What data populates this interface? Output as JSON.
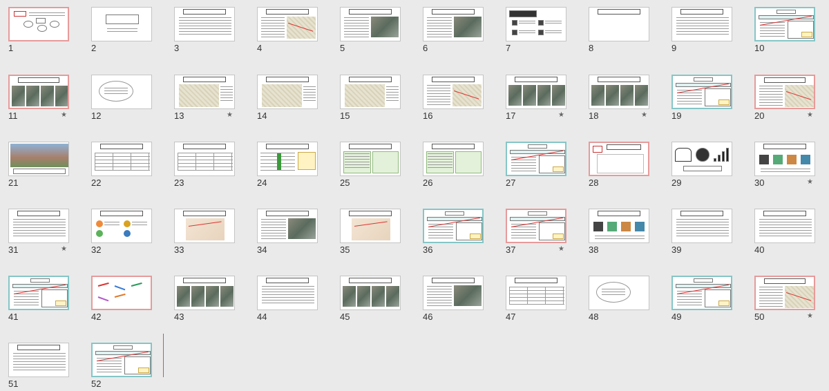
{
  "app": {
    "view": "Slide Sorter",
    "accent_color": "#c0603a"
  },
  "slides": [
    {
      "n": "1",
      "kind": "flow",
      "border": "red",
      "star": false
    },
    {
      "n": "2",
      "kind": "title",
      "border": "none",
      "star": false
    },
    {
      "n": "3",
      "kind": "text",
      "border": "none",
      "star": false
    },
    {
      "n": "4",
      "kind": "textmap",
      "border": "none",
      "star": false
    },
    {
      "n": "5",
      "kind": "textpic",
      "border": "none",
      "star": false
    },
    {
      "n": "6",
      "kind": "textpic",
      "border": "none",
      "star": false
    },
    {
      "n": "7",
      "kind": "list",
      "border": "none",
      "star": false
    },
    {
      "n": "8",
      "kind": "blank",
      "border": "none",
      "star": false
    },
    {
      "n": "9",
      "kind": "text",
      "border": "none",
      "star": false
    },
    {
      "n": "10",
      "kind": "lesson",
      "border": "teal",
      "star": false
    },
    {
      "n": "11",
      "kind": "photos",
      "border": "red",
      "star": true
    },
    {
      "n": "12",
      "kind": "cloud",
      "border": "none",
      "star": false
    },
    {
      "n": "13",
      "kind": "map",
      "border": "none",
      "star": true
    },
    {
      "n": "14",
      "kind": "map",
      "border": "none",
      "star": false
    },
    {
      "n": "15",
      "kind": "map",
      "border": "none",
      "star": false
    },
    {
      "n": "16",
      "kind": "textmap",
      "border": "none",
      "star": false
    },
    {
      "n": "17",
      "kind": "photos",
      "border": "none",
      "star": true
    },
    {
      "n": "18",
      "kind": "photos",
      "border": "none",
      "star": true
    },
    {
      "n": "19",
      "kind": "lesson",
      "border": "teal",
      "star": false
    },
    {
      "n": "20",
      "kind": "textmap",
      "border": "red",
      "star": true
    },
    {
      "n": "21",
      "kind": "photo",
      "border": "none",
      "star": false
    },
    {
      "n": "22",
      "kind": "table",
      "border": "none",
      "star": false
    },
    {
      "n": "23",
      "kind": "table",
      "border": "none",
      "star": false
    },
    {
      "n": "24",
      "kind": "greentable",
      "border": "none",
      "star": false
    },
    {
      "n": "25",
      "kind": "green",
      "border": "none",
      "star": false
    },
    {
      "n": "26",
      "kind": "green",
      "border": "none",
      "star": false
    },
    {
      "n": "27",
      "kind": "lesson",
      "border": "teal",
      "star": false
    },
    {
      "n": "28",
      "kind": "worldmap",
      "border": "red",
      "star": false
    },
    {
      "n": "29",
      "kind": "charts",
      "border": "none",
      "star": false
    },
    {
      "n": "30",
      "kind": "icons",
      "border": "none",
      "star": true
    },
    {
      "n": "31",
      "kind": "text",
      "border": "none",
      "star": true
    },
    {
      "n": "32",
      "kind": "circles",
      "border": "none",
      "star": false
    },
    {
      "n": "33",
      "kind": "sketch",
      "border": "none",
      "star": false
    },
    {
      "n": "34",
      "kind": "textpic",
      "border": "none",
      "star": false
    },
    {
      "n": "35",
      "kind": "sketch",
      "border": "none",
      "star": false
    },
    {
      "n": "36",
      "kind": "lesson",
      "border": "teal",
      "star": false
    },
    {
      "n": "37",
      "kind": "lesson",
      "border": "red",
      "star": true
    },
    {
      "n": "38",
      "kind": "icons",
      "border": "none",
      "star": false
    },
    {
      "n": "39",
      "kind": "text",
      "border": "none",
      "star": false
    },
    {
      "n": "40",
      "kind": "text",
      "border": "none",
      "star": false
    },
    {
      "n": "41",
      "kind": "lesson",
      "border": "teal",
      "star": false
    },
    {
      "n": "42",
      "kind": "scribble",
      "border": "red",
      "star": false
    },
    {
      "n": "43",
      "kind": "photos",
      "border": "none",
      "star": false
    },
    {
      "n": "44",
      "kind": "text",
      "border": "none",
      "star": false
    },
    {
      "n": "45",
      "kind": "photos",
      "border": "none",
      "star": false
    },
    {
      "n": "46",
      "kind": "textpic",
      "border": "none",
      "star": false
    },
    {
      "n": "47",
      "kind": "table",
      "border": "none",
      "star": false
    },
    {
      "n": "48",
      "kind": "cloud",
      "border": "none",
      "star": false
    },
    {
      "n": "49",
      "kind": "lesson",
      "border": "teal",
      "star": false
    },
    {
      "n": "50",
      "kind": "textmap",
      "border": "red",
      "star": true
    },
    {
      "n": "51",
      "kind": "text",
      "border": "none",
      "star": false
    },
    {
      "n": "52",
      "kind": "lesson",
      "border": "teal",
      "star": false
    }
  ],
  "star_glyph": "★"
}
